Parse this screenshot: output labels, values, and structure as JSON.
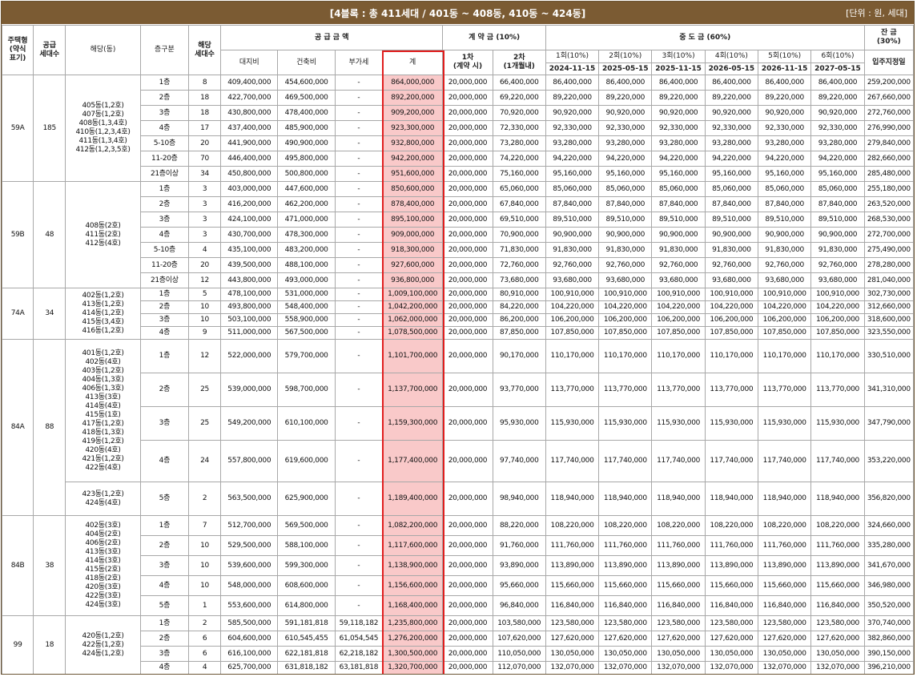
{
  "header": {
    "title": "[4블록 : 총 411세대 / 401동 ~ 408동, 410동 ~ 424동]",
    "unit": "[단위 : 원, 세대]"
  },
  "columns": {
    "type": "주택형\n(약식\n표기)",
    "supply_units": "공급\n세대수",
    "dongs": "해당(동)",
    "floor": "층구분",
    "units": "해당\n세대수",
    "supply_price": "공 급 금 액",
    "land": "대지비",
    "building": "건축비",
    "vat": "부가세",
    "total": "계",
    "contract": "계 약 금 (10%)",
    "c1": "1차\n(계약 시)",
    "c2": "2차\n(1개월내)",
    "middle": "중 도 금 (60%)",
    "m": [
      {
        "label": "1회(10%)",
        "date": "2024-11-15"
      },
      {
        "label": "2회(10%)",
        "date": "2025-05-15"
      },
      {
        "label": "3회(10%)",
        "date": "2025-11-15"
      },
      {
        "label": "4회(10%)",
        "date": "2026-05-15"
      },
      {
        "label": "5회(10%)",
        "date": "2026-11-15"
      },
      {
        "label": "6회(10%)",
        "date": "2027-05-15"
      }
    ],
    "balance": "잔 금\n(30%)",
    "balance_sub": "입주지정일"
  },
  "groups": [
    {
      "type": "59A",
      "supply": "185",
      "dong_blocks": [
        {
          "text": "405동(1,2호)\n407동(1,2호)\n408동(1,3,4호)\n410동(1,2,3,4호)\n411동(1,3,4호)\n412동(1,2,3,5호)",
          "span": 7
        }
      ],
      "rows": [
        {
          "floor": "1층",
          "units": "8",
          "land": "409,400,000",
          "building": "454,600,000",
          "vat": "-",
          "total": "864,000,000",
          "c1": "20,000,000",
          "c2": "66,400,000",
          "m": "86,400,000",
          "bal": "259,200,000"
        },
        {
          "floor": "2층",
          "units": "18",
          "land": "422,700,000",
          "building": "469,500,000",
          "vat": "-",
          "total": "892,200,000",
          "c1": "20,000,000",
          "c2": "69,220,000",
          "m": "89,220,000",
          "bal": "267,660,000"
        },
        {
          "floor": "3층",
          "units": "18",
          "land": "430,800,000",
          "building": "478,400,000",
          "vat": "-",
          "total": "909,200,000",
          "c1": "20,000,000",
          "c2": "70,920,000",
          "m": "90,920,000",
          "bal": "272,760,000"
        },
        {
          "floor": "4층",
          "units": "17",
          "land": "437,400,000",
          "building": "485,900,000",
          "vat": "-",
          "total": "923,300,000",
          "c1": "20,000,000",
          "c2": "72,330,000",
          "m": "92,330,000",
          "bal": "276,990,000"
        },
        {
          "floor": "5-10층",
          "units": "20",
          "land": "441,900,000",
          "building": "490,900,000",
          "vat": "-",
          "total": "932,800,000",
          "c1": "20,000,000",
          "c2": "73,280,000",
          "m": "93,280,000",
          "bal": "279,840,000"
        },
        {
          "floor": "11-20층",
          "units": "70",
          "land": "446,400,000",
          "building": "495,800,000",
          "vat": "-",
          "total": "942,200,000",
          "c1": "20,000,000",
          "c2": "74,220,000",
          "m": "94,220,000",
          "bal": "282,660,000"
        },
        {
          "floor": "21층이상",
          "units": "34",
          "land": "450,800,000",
          "building": "500,800,000",
          "vat": "-",
          "total": "951,600,000",
          "c1": "20,000,000",
          "c2": "75,160,000",
          "m": "95,160,000",
          "bal": "285,480,000"
        }
      ]
    },
    {
      "type": "59B",
      "supply": "48",
      "dong_blocks": [
        {
          "text": "408동(2호)\n411동(2호)\n412동(4호)",
          "span": 7
        }
      ],
      "rows": [
        {
          "floor": "1층",
          "units": "3",
          "land": "403,000,000",
          "building": "447,600,000",
          "vat": "-",
          "total": "850,600,000",
          "c1": "20,000,000",
          "c2": "65,060,000",
          "m": "85,060,000",
          "bal": "255,180,000"
        },
        {
          "floor": "2층",
          "units": "3",
          "land": "416,200,000",
          "building": "462,200,000",
          "vat": "-",
          "total": "878,400,000",
          "c1": "20,000,000",
          "c2": "67,840,000",
          "m": "87,840,000",
          "bal": "263,520,000"
        },
        {
          "floor": "3층",
          "units": "3",
          "land": "424,100,000",
          "building": "471,000,000",
          "vat": "-",
          "total": "895,100,000",
          "c1": "20,000,000",
          "c2": "69,510,000",
          "m": "89,510,000",
          "bal": "268,530,000"
        },
        {
          "floor": "4층",
          "units": "3",
          "land": "430,700,000",
          "building": "478,300,000",
          "vat": "-",
          "total": "909,000,000",
          "c1": "20,000,000",
          "c2": "70,900,000",
          "m": "90,900,000",
          "bal": "272,700,000"
        },
        {
          "floor": "5-10층",
          "units": "4",
          "land": "435,100,000",
          "building": "483,200,000",
          "vat": "-",
          "total": "918,300,000",
          "c1": "20,000,000",
          "c2": "71,830,000",
          "m": "91,830,000",
          "bal": "275,490,000"
        },
        {
          "floor": "11-20층",
          "units": "20",
          "land": "439,500,000",
          "building": "488,100,000",
          "vat": "-",
          "total": "927,600,000",
          "c1": "20,000,000",
          "c2": "72,760,000",
          "m": "92,760,000",
          "bal": "278,280,000"
        },
        {
          "floor": "21층이상",
          "units": "12",
          "land": "443,800,000",
          "building": "493,000,000",
          "vat": "-",
          "total": "936,800,000",
          "c1": "20,000,000",
          "c2": "73,680,000",
          "m": "93,680,000",
          "bal": "281,040,000"
        }
      ]
    },
    {
      "type": "74A",
      "supply": "34",
      "dong_blocks": [
        {
          "text": "402동(1,2호)\n413동(1,2호)\n414동(1,2호)\n415동(3,4호)\n416동(1,2호)",
          "span": 4
        }
      ],
      "rows": [
        {
          "floor": "1층",
          "units": "5",
          "land": "478,100,000",
          "building": "531,000,000",
          "vat": "-",
          "total": "1,009,100,000",
          "c1": "20,000,000",
          "c2": "80,910,000",
          "m": "100,910,000",
          "bal": "302,730,000"
        },
        {
          "floor": "2층",
          "units": "10",
          "land": "493,800,000",
          "building": "548,400,000",
          "vat": "-",
          "total": "1,042,200,000",
          "c1": "20,000,000",
          "c2": "84,220,000",
          "m": "104,220,000",
          "bal": "312,660,000"
        },
        {
          "floor": "3층",
          "units": "10",
          "land": "503,100,000",
          "building": "558,900,000",
          "vat": "-",
          "total": "1,062,000,000",
          "c1": "20,000,000",
          "c2": "86,200,000",
          "m": "106,200,000",
          "bal": "318,600,000"
        },
        {
          "floor": "4층",
          "units": "9",
          "land": "511,000,000",
          "building": "567,500,000",
          "vat": "-",
          "total": "1,078,500,000",
          "c1": "20,000,000",
          "c2": "87,850,000",
          "m": "107,850,000",
          "bal": "323,550,000"
        }
      ]
    },
    {
      "type": "84A",
      "supply": "88",
      "dong_blocks": [
        {
          "text": "401동(1,2호)\n402동(4호)\n403동(1,2호)\n404동(1,3호)\n406동(1,3호)\n413동(3호)\n414동(4호)\n415동(1호)\n417동(1,2호)\n418동(1,3호)\n419동(1,2호)\n420동(4호)\n421동(1,2호)\n422동(4호)",
          "span": 4
        },
        {
          "text": "423동(1,2호)\n424동(4호)",
          "span": 1
        }
      ],
      "rows": [
        {
          "floor": "1층",
          "units": "12",
          "land": "522,000,000",
          "building": "579,700,000",
          "vat": "-",
          "total": "1,101,700,000",
          "c1": "20,000,000",
          "c2": "90,170,000",
          "m": "110,170,000",
          "bal": "330,510,000"
        },
        {
          "floor": "2층",
          "units": "25",
          "land": "539,000,000",
          "building": "598,700,000",
          "vat": "-",
          "total": "1,137,700,000",
          "c1": "20,000,000",
          "c2": "93,770,000",
          "m": "113,770,000",
          "bal": "341,310,000"
        },
        {
          "floor": "3층",
          "units": "25",
          "land": "549,200,000",
          "building": "610,100,000",
          "vat": "-",
          "total": "1,159,300,000",
          "c1": "20,000,000",
          "c2": "95,930,000",
          "m": "115,930,000",
          "bal": "347,790,000"
        },
        {
          "floor": "4층",
          "units": "24",
          "land": "557,800,000",
          "building": "619,600,000",
          "vat": "-",
          "total": "1,177,400,000",
          "c1": "20,000,000",
          "c2": "97,740,000",
          "m": "117,740,000",
          "bal": "353,220,000"
        },
        {
          "floor": "5층",
          "units": "2",
          "land": "563,500,000",
          "building": "625,900,000",
          "vat": "-",
          "total": "1,189,400,000",
          "c1": "20,000,000",
          "c2": "98,940,000",
          "m": "118,940,000",
          "bal": "356,820,000"
        }
      ]
    },
    {
      "type": "84B",
      "supply": "38",
      "dong_blocks": [
        {
          "text": "402동(3호)\n404동(2호)\n406동(2호)\n413동(3호)\n414동(3호)\n415동(2호)\n418동(2호)\n420동(3호)\n422동(3호)\n424동(3호)",
          "span": 5
        }
      ],
      "rows": [
        {
          "floor": "1층",
          "units": "7",
          "land": "512,700,000",
          "building": "569,500,000",
          "vat": "-",
          "total": "1,082,200,000",
          "c1": "20,000,000",
          "c2": "88,220,000",
          "m": "108,220,000",
          "bal": "324,660,000"
        },
        {
          "floor": "2층",
          "units": "10",
          "land": "529,500,000",
          "building": "588,100,000",
          "vat": "-",
          "total": "1,117,600,000",
          "c1": "20,000,000",
          "c2": "91,760,000",
          "m": "111,760,000",
          "bal": "335,280,000"
        },
        {
          "floor": "3층",
          "units": "10",
          "land": "539,600,000",
          "building": "599,300,000",
          "vat": "-",
          "total": "1,138,900,000",
          "c1": "20,000,000",
          "c2": "93,890,000",
          "m": "113,890,000",
          "bal": "341,670,000"
        },
        {
          "floor": "4층",
          "units": "10",
          "land": "548,000,000",
          "building": "608,600,000",
          "vat": "-",
          "total": "1,156,600,000",
          "c1": "20,000,000",
          "c2": "95,660,000",
          "m": "115,660,000",
          "bal": "346,980,000"
        },
        {
          "floor": "5층",
          "units": "1",
          "land": "553,600,000",
          "building": "614,800,000",
          "vat": "-",
          "total": "1,168,400,000",
          "c1": "20,000,000",
          "c2": "96,840,000",
          "m": "116,840,000",
          "bal": "350,520,000"
        }
      ]
    },
    {
      "type": "99",
      "supply": "18",
      "dong_blocks": [
        {
          "text": "420동(1,2호)\n422동(1,2호)\n424동(1,2호)",
          "span": 4
        }
      ],
      "rows": [
        {
          "floor": "1층",
          "units": "2",
          "land": "585,500,000",
          "building": "591,181,818",
          "vat": "59,118,182",
          "total": "1,235,800,000",
          "c1": "20,000,000",
          "c2": "103,580,000",
          "m": "123,580,000",
          "bal": "370,740,000"
        },
        {
          "floor": "2층",
          "units": "6",
          "land": "604,600,000",
          "building": "610,545,455",
          "vat": "61,054,545",
          "total": "1,276,200,000",
          "c1": "20,000,000",
          "c2": "107,620,000",
          "m": "127,620,000",
          "bal": "382,860,000"
        },
        {
          "floor": "3층",
          "units": "6",
          "land": "616,100,000",
          "building": "622,181,818",
          "vat": "62,218,182",
          "total": "1,300,500,000",
          "c1": "20,000,000",
          "c2": "110,050,000",
          "m": "130,050,000",
          "bal": "390,150,000"
        },
        {
          "floor": "4층",
          "units": "4",
          "land": "625,700,000",
          "building": "631,818,182",
          "vat": "63,181,818",
          "total": "1,320,700,000",
          "c1": "20,000,000",
          "c2": "112,070,000",
          "m": "132,070,000",
          "bal": "396,210,000"
        }
      ]
    }
  ]
}
